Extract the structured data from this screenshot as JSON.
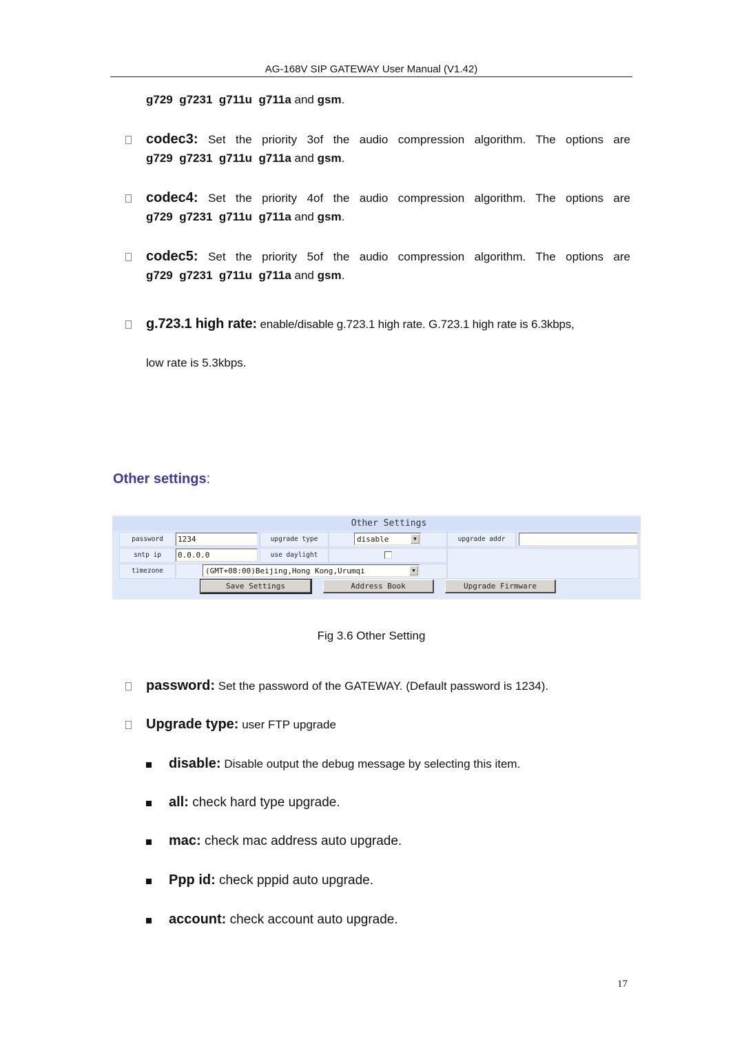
{
  "header": {
    "title": "AG-168V SIP GATEWAY User Manual (V1.42)"
  },
  "codec_options": {
    "g729": "g729",
    "g7231": "g7231",
    "g711u": "g711u",
    "g711a": "g711a",
    "and": "and",
    "gsm": "gsm",
    "period": "."
  },
  "items": [
    {
      "term": "codec3:",
      "text": "Set the priority 3of the audio compression algorithm. The options are"
    },
    {
      "term": "codec4:",
      "text": "Set the priority 4of the audio compression algorithm. The options are"
    },
    {
      "term": "codec5:",
      "text": "Set the priority 5of the audio compression algorithm. The options are"
    }
  ],
  "g7231_item": {
    "term": "g.723.1 high rate:",
    "text": "enable/disable g.723.1 high rate. G.723.1 high rate is 6.3kbps,",
    "continuation": "low rate is 5.3kbps."
  },
  "section": {
    "title": "Other settings",
    "colon": ":"
  },
  "settings_panel": {
    "title": "Other Settings",
    "password_label": "password",
    "password_value": "1234",
    "upgrade_type_label": "upgrade type",
    "upgrade_type_value": "disable",
    "upgrade_addr_label": "upgrade addr",
    "upgrade_addr_value": "",
    "sntp_ip_label": "sntp ip",
    "sntp_ip_value": "0.0.0.0",
    "use_daylight_label": "use daylight",
    "use_daylight_checked": false,
    "timezone_label": "timezone",
    "timezone_value": "(GMT+08:00)Beijing,Hong Kong,Urumqi",
    "save_button": "Save Settings",
    "address_book_button": "Address Book",
    "upgrade_firmware_button": "Upgrade Firmware",
    "dropdown_arrow": "▼"
  },
  "caption": "Fig 3.6 Other Setting",
  "descriptions": [
    {
      "term": "password:",
      "text": "Set the password of the GATEWAY. (Default password is 1234)."
    },
    {
      "term": "Upgrade type:",
      "text": "user FTP upgrade"
    }
  ],
  "upgrade_options": [
    {
      "term": "disable:",
      "text": "Disable output the debug message by selecting this item."
    },
    {
      "term": "all:",
      "text": "check hard type upgrade."
    },
    {
      "term": "mac:",
      "text": "check mac address auto upgrade."
    },
    {
      "term": "Ppp id:",
      "text": "check pppid auto upgrade."
    },
    {
      "term": "account:",
      "text": "check account auto upgrade."
    }
  ],
  "page_number": "17"
}
